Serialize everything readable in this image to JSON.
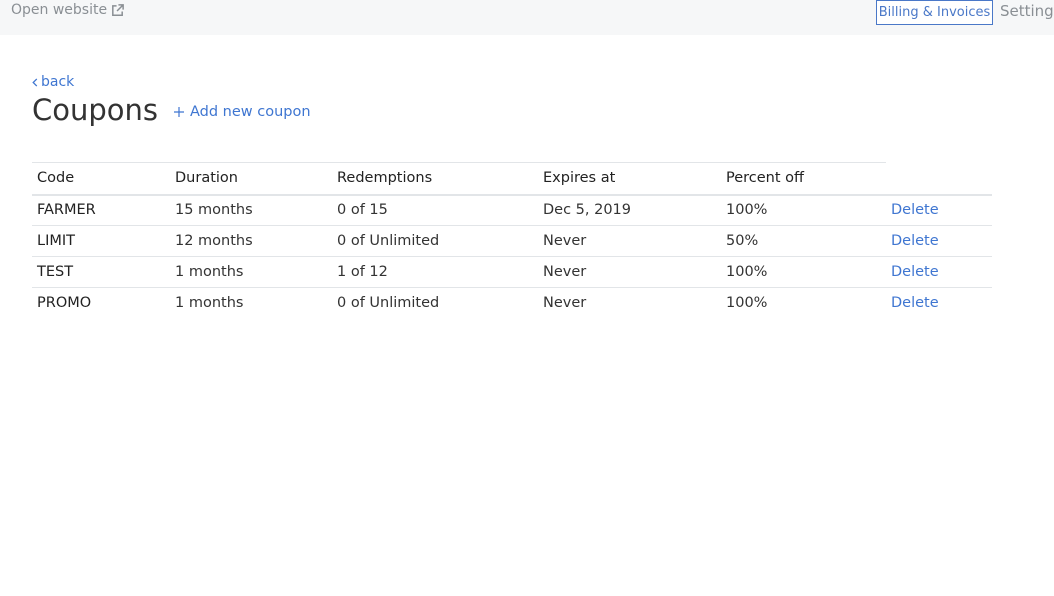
{
  "topbar": {
    "open_website_label": "Open website",
    "billing_label": "Billing & Invoices",
    "settings_label": "Settings"
  },
  "page": {
    "back_label": "back",
    "title": "Coupons",
    "add_label": "Add new coupon"
  },
  "table": {
    "headers": [
      "Code",
      "Duration",
      "Redemptions",
      "Expires at",
      "Percent off"
    ],
    "rows": [
      {
        "code": "FARMER",
        "duration": "15 months",
        "redemptions": "0 of 15",
        "expires": "Dec 5, 2019",
        "percent": "100%",
        "action": "Delete"
      },
      {
        "code": "LIMIT",
        "duration": "12 months",
        "redemptions": "0 of Unlimited",
        "expires": "Never",
        "percent": "50%",
        "action": "Delete"
      },
      {
        "code": "TEST",
        "duration": "1 months",
        "redemptions": "1 of 12",
        "expires": "Never",
        "percent": "100%",
        "action": "Delete"
      },
      {
        "code": "PROMO",
        "duration": "1 months",
        "redemptions": "0 of Unlimited",
        "expires": "Never",
        "percent": "100%",
        "action": "Delete"
      }
    ]
  },
  "icons": {
    "external_link": "external-link-icon",
    "back": "chevron-left-icon",
    "add": "plus-icon"
  },
  "colors": {
    "link": "#3f76d1",
    "topbar_bg": "#f6f7f8",
    "muted_text": "#8a8f94",
    "border": "#e2e5e8"
  }
}
